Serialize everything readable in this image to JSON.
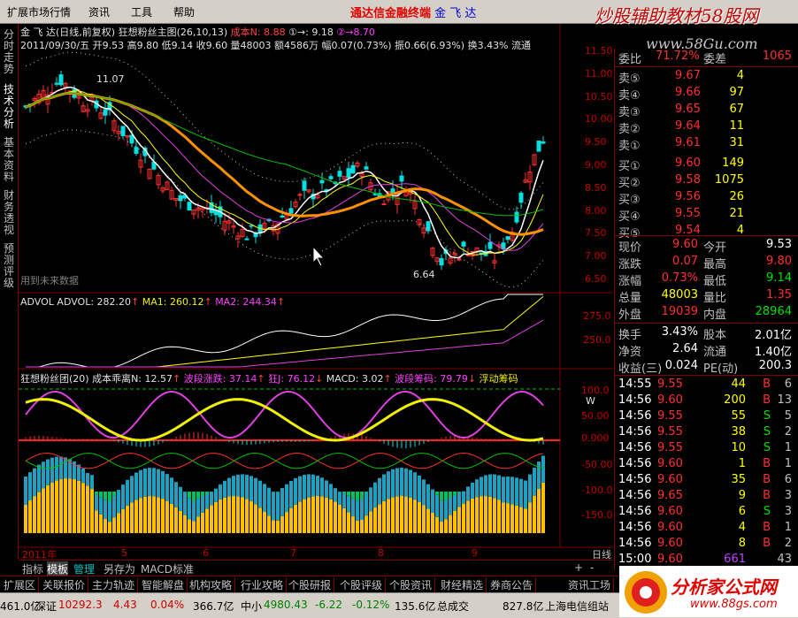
{
  "menu": {
    "items": [
      "扩展市场行情",
      "资讯",
      "工具",
      "帮助"
    ],
    "brand": "通达信金融终端",
    "stock": "金 飞 达"
  },
  "watermark": {
    "top": "炒股辅助教材58股网",
    "url": "www.58Gu.com",
    "bottom_title": "分析家公式网",
    "bottom_url": "www.88gs.com"
  },
  "left_tabs": [
    "分时走势",
    "技术分析",
    "基本资料",
    "财务透视",
    "预测评级"
  ],
  "kline": {
    "title": "金 飞 达(日线,前复权) 狂想粉丝主图(26,10,13)",
    "cost_label": "成本N",
    "cost_value": ": 8.88",
    "v1": ": 9.18",
    "v2": "8.70",
    "date_line": "2011/09/30/五 开9.53 高9.80 低9.14 收9.60 量48003 额4586万 幅0.07(0.73%) 振0.66(6.93%) 换3.43% 流通",
    "high_label": "11.07",
    "low_label": "6.64",
    "future_note": "用到未来数据",
    "yticks": [
      "11.50",
      "11.00",
      "10.50",
      "10.00",
      "9.50",
      "9.00",
      "8.50",
      "8.00",
      "7.50",
      "7.00",
      "6.50"
    ]
  },
  "advol": {
    "title": "ADVOL ADVOL: 282.20",
    "ma1": "MA1: 260.12",
    "ma2": "MA2: 244.34",
    "yticks": [
      "275.0",
      "250.0"
    ]
  },
  "osc": {
    "title": "狂想粉丝团(20) 成本乖离N: 12.57",
    "wave": "波段涨跌: 37.14",
    "kdj": "狂J: 76.12",
    "macd": "MACD: 3.02",
    "chip": "波段筹码: 79.79",
    "float": "浮动筹码",
    "w": "W",
    "yticks": [
      "100.0",
      "50.00",
      "0.000",
      "-50.00",
      "-100.0",
      "-150.0"
    ]
  },
  "xaxis": {
    "labels": [
      "2011年",
      "5",
      "6",
      "7",
      "8",
      "9"
    ],
    "period": "日线"
  },
  "quote": {
    "wb_label": "委比",
    "wb": "71.72%",
    "wc_label": "委差",
    "wc": "1065",
    "sell": [
      [
        "卖⑤",
        "9.67",
        "4"
      ],
      [
        "卖④",
        "9.66",
        "97"
      ],
      [
        "卖③",
        "9.65",
        "67"
      ],
      [
        "卖②",
        "9.64",
        "11"
      ],
      [
        "卖①",
        "9.61",
        "31"
      ]
    ],
    "buy": [
      [
        "买①",
        "9.60",
        "149"
      ],
      [
        "买②",
        "9.58",
        "1075"
      ],
      [
        "买③",
        "9.56",
        "26"
      ],
      [
        "买④",
        "9.55",
        "21"
      ],
      [
        "买⑤",
        "9.54",
        "4"
      ]
    ],
    "stats": [
      [
        "现价",
        "9.60",
        "今开",
        "9.53"
      ],
      [
        "涨跌",
        "0.07",
        "最高",
        "9.80"
      ],
      [
        "涨幅",
        "0.73%",
        "最低",
        "9.14"
      ],
      [
        "总量",
        "48003",
        "量比",
        "1.35"
      ],
      [
        "外盘",
        "19039",
        "内盘",
        "28964"
      ]
    ],
    "stats2": [
      [
        "换手",
        "3.43%",
        "股本",
        "2.01亿"
      ],
      [
        "净资",
        "2.64",
        "流通",
        "1.40亿"
      ],
      [
        "收益(三)",
        "0.024",
        "PE(动)",
        "200.3"
      ]
    ],
    "ticks": [
      [
        "14:55",
        "9.55",
        "44",
        "B",
        "6"
      ],
      [
        "14:56",
        "9.60",
        "200",
        "B",
        "13"
      ],
      [
        "14:56",
        "9.55",
        "55",
        "S",
        "5"
      ],
      [
        "14:56",
        "9.55",
        "38",
        "S",
        "2"
      ],
      [
        "14:56",
        "9.55",
        "10",
        "S",
        "1"
      ],
      [
        "14:56",
        "9.60",
        "1",
        "B",
        "1"
      ],
      [
        "14:56",
        "9.60",
        "35",
        "B",
        "6"
      ],
      [
        "14:56",
        "9.65",
        "9",
        "B",
        "3"
      ],
      [
        "14:56",
        "9.60",
        "6",
        "S",
        "3"
      ],
      [
        "14:56",
        "9.60",
        "4",
        "B",
        "1"
      ],
      [
        "14:56",
        "9.60",
        "8",
        "B",
        "2"
      ],
      [
        "15:00",
        "9.60",
        "661",
        "",
        "43"
      ]
    ]
  },
  "bottom_tabs": [
    "指标",
    "模板",
    "管理",
    "另存为",
    "MACD标准"
  ],
  "bottom_buttons": [
    "扩展区",
    "关联报价",
    "主力轨迹",
    "智能解盘",
    "机构攻略",
    "行业攻略",
    "个股研报",
    "个股评级",
    "个股资讯",
    "财经精选",
    "券商公告",
    "资讯工场"
  ],
  "status": {
    "sh": "461.0亿",
    "sz_label": "深证",
    "sz": "10292.3",
    "sz_chg": "4.43",
    "sz_pct": "0.04%",
    "sz_amt": "366.7亿",
    "zx_label": "中小",
    "zx": "4980.43",
    "zx_chg": "-6.22",
    "zx_pct": "-0.12%",
    "zx_amt": "135.6亿",
    "done": "总成交",
    "done_amt": "827.8亿",
    "site": "上海电信组站"
  },
  "colors": {
    "up": "#ff3030",
    "down": "#00e0e0",
    "ma_orange": "#ff9000",
    "ma_yellow": "#ffff00",
    "ma_mag": "#e040e0",
    "ma_green": "#00c000"
  }
}
